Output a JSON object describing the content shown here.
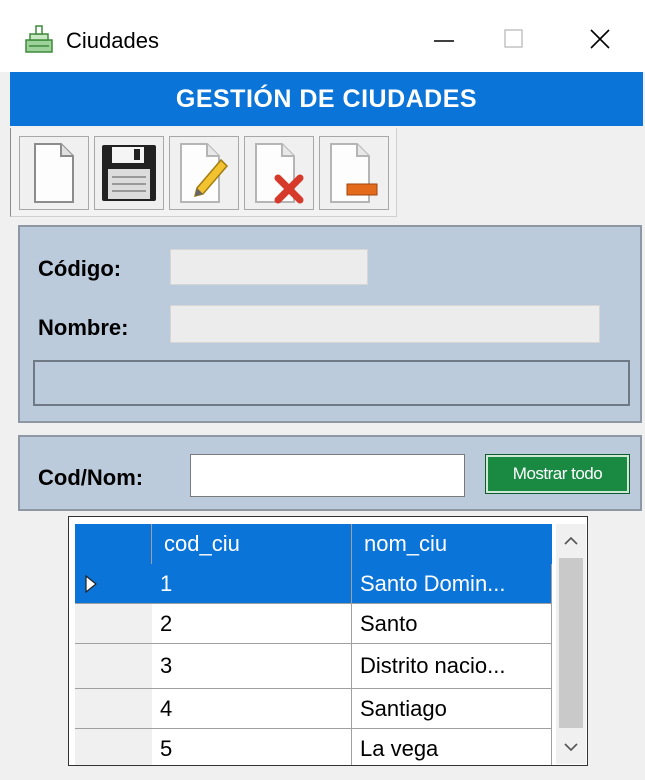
{
  "window": {
    "title": "Ciudades"
  },
  "header": {
    "title": "GESTIÓN DE CIUDADES"
  },
  "toolbar": {
    "buttons": [
      "new-icon",
      "save-icon",
      "edit-icon",
      "delete-icon",
      "close-icon"
    ]
  },
  "form": {
    "codigo_label": "Código:",
    "nombre_label": "Nombre:",
    "codigo_value": "",
    "nombre_value": ""
  },
  "search": {
    "label": "Cod/Nom:",
    "value": "",
    "show_all_label": "Mostrar todo"
  },
  "grid": {
    "columns": [
      "cod_ciu",
      "nom_ciu"
    ],
    "rows": [
      {
        "cod": "1",
        "nom": "Santo Domin..."
      },
      {
        "cod": "2",
        "nom": "Santo"
      },
      {
        "cod": "3",
        "nom": "Distrito nacio..."
      },
      {
        "cod": "4",
        "nom": "Santiago"
      },
      {
        "cod": "5",
        "nom": "La vega"
      }
    ]
  },
  "colors": {
    "accent": "#0a74d8",
    "panel": "#bccbdc",
    "button_green": "#1a8a43"
  }
}
